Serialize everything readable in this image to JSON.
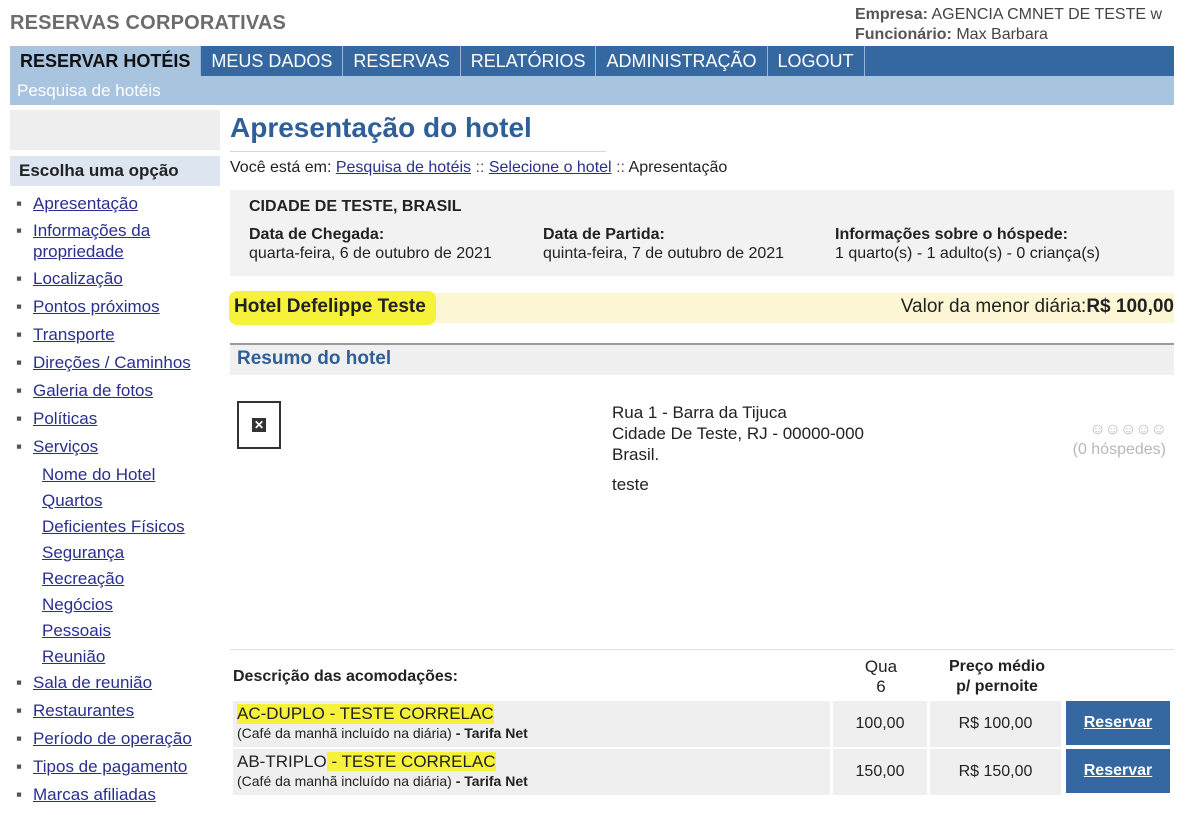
{
  "header": {
    "brand": "RESERVAS CORPORATIVAS",
    "empresa_label": "Empresa:",
    "empresa_value": "AGENCIA CMNET DE TESTE w",
    "funcionario_label": "Funcionário:",
    "funcionario_value": "Max Barbara"
  },
  "nav": {
    "items": [
      "RESERVAR HOTÉIS",
      "MEUS DADOS",
      "RESERVAS",
      "RELATÓRIOS",
      "ADMINISTRAÇÃO",
      "LOGOUT"
    ],
    "active_index": 0,
    "sub_label": "Pesquisa de hotéis"
  },
  "sidebar": {
    "title": "Escolha uma opção",
    "items": [
      "Apresentação",
      "Informações da propriedade",
      "Localização",
      "Pontos próximos",
      "Transporte",
      "Direções / Caminhos",
      "Galeria de fotos",
      "Políticas",
      "Serviços"
    ],
    "sub_items": [
      "Nome do Hotel",
      "Quartos",
      "Deficientes Físicos",
      "Segurança",
      "Recreação",
      "Negócios",
      "Pessoais",
      "Reunião"
    ],
    "items_after": [
      "Sala de reunião",
      "Restaurantes",
      "Período de operação",
      "Tipos de pagamento",
      "Marcas afiliadas"
    ]
  },
  "page": {
    "title": "Apresentação do hotel",
    "breadcrumb": {
      "prefix": "Você está em:",
      "link1": "Pesquisa de hotéis",
      "sep": "::",
      "link2": "Selecione o hotel",
      "current": "Apresentação"
    }
  },
  "search": {
    "city": "CIDADE DE TESTE, BRASIL",
    "checkin_label": "Data de Chegada:",
    "checkin_value": "quarta-feira, 6 de outubro de 2021",
    "checkout_label": "Data de Partida:",
    "checkout_value": "quinta-feira, 7 de outubro de 2021",
    "guests_label": "Informações sobre o hóspede:",
    "guests_value": "1 quarto(s) - 1 adulto(s) - 0 criança(s)"
  },
  "hotel": {
    "name": "Hotel Defelippe Teste",
    "min_price_label": "Valor da menor diária:",
    "min_price_value": "R$ 100,00",
    "summary_title": "Resumo do hotel",
    "address_line1": "Rua 1 - Barra da Tijuca",
    "address_line2": "Cidade De Teste, RJ - 00000-000",
    "address_line3": "Brasil.",
    "description": "teste",
    "rating_icons": "☺☺☺☺☺",
    "reviews": "(0 hóspedes)"
  },
  "rooms": {
    "header_desc": "Descrição das acomodações:",
    "header_qty_line1": "Qua",
    "header_qty_line2": "6",
    "header_price_line1": "Preço médio",
    "header_price_line2": "p/ pernoite",
    "list": [
      {
        "name": "AC-DUPLO - TESTE CORRELAC",
        "note": "(Café da manhã incluído na diária)",
        "tariff": "- Tarifa Net",
        "qty": "100,00",
        "price": "R$ 100,00",
        "button": "Reservar"
      },
      {
        "name_part1": "AB-TRIPLO",
        "name_part2": " - TESTE CORRELAC",
        "note": "(Café da manhã incluído na diária)",
        "tariff": "- Tarifa Net",
        "qty": "150,00",
        "price": "R$ 150,00",
        "button": "Reservar"
      }
    ]
  },
  "colors": {
    "nav_blue": "#3567a0",
    "subnav_blue": "#a9c4df",
    "title_blue": "#2f5f98",
    "highlight_yellow": "#f6f23c"
  }
}
